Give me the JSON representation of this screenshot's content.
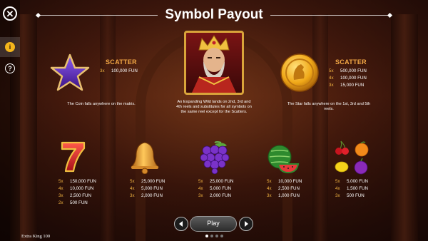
{
  "title": "Symbol Payout",
  "sidebar": {
    "close_icon": "close-icon",
    "info_icon": "info-icon",
    "help_icon": "help-icon",
    "info_glyph": "i",
    "help_glyph": "?",
    "close_glyph": "✕"
  },
  "star": {
    "label": "SCATTER",
    "pays": [
      {
        "mult": "3x",
        "value": "100,000 FUN"
      }
    ],
    "description": "The Coin falls anywhere on the matrix."
  },
  "wild": {
    "description": "An Expanding Wild lands on 2nd, 3rd and 4th reels and substitutes for all symbols on the same reel except for the Scatters."
  },
  "coin": {
    "label": "SCATTER",
    "pays": [
      {
        "mult": "5x",
        "value": "500,000 FUN"
      },
      {
        "mult": "4x",
        "value": "100,000 FUN"
      },
      {
        "mult": "3x",
        "value": "15,000 FUN"
      }
    ],
    "description": "The Star falls anywhere on the 1st, 3rd and 5th reels."
  },
  "seven": {
    "pays": [
      {
        "mult": "5x",
        "value": "150,000 FUN"
      },
      {
        "mult": "4x",
        "value": "10,000 FUN"
      },
      {
        "mult": "3x",
        "value": "2,500 FUN"
      },
      {
        "mult": "2x",
        "value": "500 FUN"
      }
    ]
  },
  "bell": {
    "pays": [
      {
        "mult": "5x",
        "value": "25,000 FUN"
      },
      {
        "mult": "4x",
        "value": "5,000 FUN"
      },
      {
        "mult": "3x",
        "value": "2,000 FUN"
      }
    ]
  },
  "grapes": {
    "pays": [
      {
        "mult": "5x",
        "value": "25,000 FUN"
      },
      {
        "mult": "4x",
        "value": "5,000 FUN"
      },
      {
        "mult": "3x",
        "value": "2,000 FUN"
      }
    ]
  },
  "melon": {
    "pays": [
      {
        "mult": "5x",
        "value": "10,000 FUN"
      },
      {
        "mult": "4x",
        "value": "2,500 FUN"
      },
      {
        "mult": "3x",
        "value": "1,000 FUN"
      }
    ]
  },
  "fruits": {
    "pays": [
      {
        "mult": "5x",
        "value": "5,000 FUN"
      },
      {
        "mult": "4x",
        "value": "1,500 FUN"
      },
      {
        "mult": "3x",
        "value": "500 FUN"
      }
    ]
  },
  "nav": {
    "play_label": "Play",
    "prev_icon": "arrow-left-icon",
    "next_icon": "arrow-right-icon",
    "page_total": 4,
    "page_current": 1
  },
  "footer": {
    "game_name": "Extra King 100"
  },
  "colors": {
    "accent": "#f3b542",
    "scatter": "#f3a845"
  }
}
